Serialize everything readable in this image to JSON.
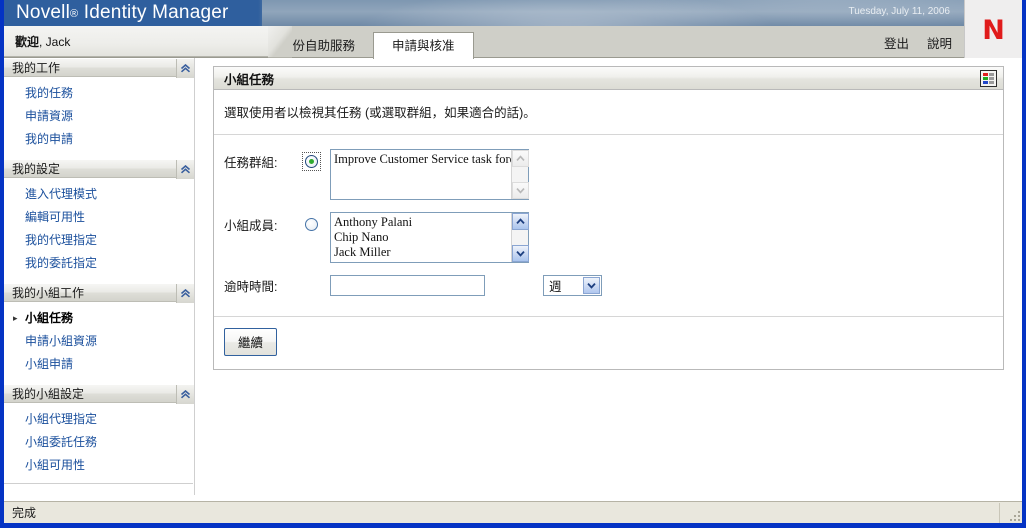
{
  "banner": {
    "product_name": "Novell",
    "registered_mark": "®",
    "product_suffix": "Identity Manager",
    "date": "Tuesday, July 11, 2006",
    "logo_letter": "N",
    "logo_color": "#e01b1b",
    "bar_color": "#2f5f9e"
  },
  "header": {
    "welcome_prefix": "歡迎",
    "welcome_user": ", Jack",
    "tabs": [
      {
        "label": "身份自助服務",
        "active": false
      },
      {
        "label": "申請與核准",
        "active": true
      }
    ],
    "links": [
      {
        "label": "登出"
      },
      {
        "label": "說明"
      }
    ]
  },
  "sidebar": {
    "groups": [
      {
        "title": "我的工作",
        "collapse_icon": "chevron-up-icon",
        "items": [
          {
            "label": "我的任務",
            "current": false
          },
          {
            "label": "申請資源",
            "current": false
          },
          {
            "label": "我的申請",
            "current": false
          }
        ]
      },
      {
        "title": "我的設定",
        "collapse_icon": "chevron-up-icon",
        "items": [
          {
            "label": "進入代理模式",
            "current": false
          },
          {
            "label": "編輯可用性",
            "current": false
          },
          {
            "label": "我的代理指定",
            "current": false
          },
          {
            "label": "我的委託指定",
            "current": false
          }
        ]
      },
      {
        "title": "我的小組工作",
        "collapse_icon": "chevron-up-icon",
        "items": [
          {
            "label": "小組任務",
            "current": true
          },
          {
            "label": "申請小組資源",
            "current": false
          },
          {
            "label": "小組申請",
            "current": false
          }
        ]
      },
      {
        "title": "我的小組設定",
        "collapse_icon": "chevron-up-icon",
        "items": [
          {
            "label": "小組代理指定",
            "current": false
          },
          {
            "label": "小組委託任務",
            "current": false
          },
          {
            "label": "小組可用性",
            "current": false
          }
        ]
      }
    ]
  },
  "panel": {
    "title": "小組任務",
    "icon": "color-grid-icon",
    "icon_colors": [
      "#e02020",
      "#9a9a9a",
      "#1fa81f",
      "#9a9a9a",
      "#2246c8",
      "#9a9a9a"
    ],
    "description": "選取使用者以檢視其任務 (或選取群組，如果適合的話)。",
    "fields": {
      "task_group": {
        "label": "任務群組:",
        "radio_selected": true,
        "options": [
          "Improve Customer Service task force"
        ],
        "scroll_up_enabled": false,
        "scroll_down_enabled": false
      },
      "team_members": {
        "label": "小組成員:",
        "radio_selected": false,
        "options": [
          "Anthony Palani",
          "Chip Nano",
          "Jack Miller"
        ],
        "scroll_up_enabled": true,
        "scroll_down_enabled": true
      },
      "timeout": {
        "label": "逾時時間:",
        "value": "",
        "placeholder": "",
        "unit_selected": "週",
        "unit_options": [
          "週"
        ]
      }
    },
    "submit_label": "繼續"
  },
  "status": {
    "text": "完成"
  }
}
